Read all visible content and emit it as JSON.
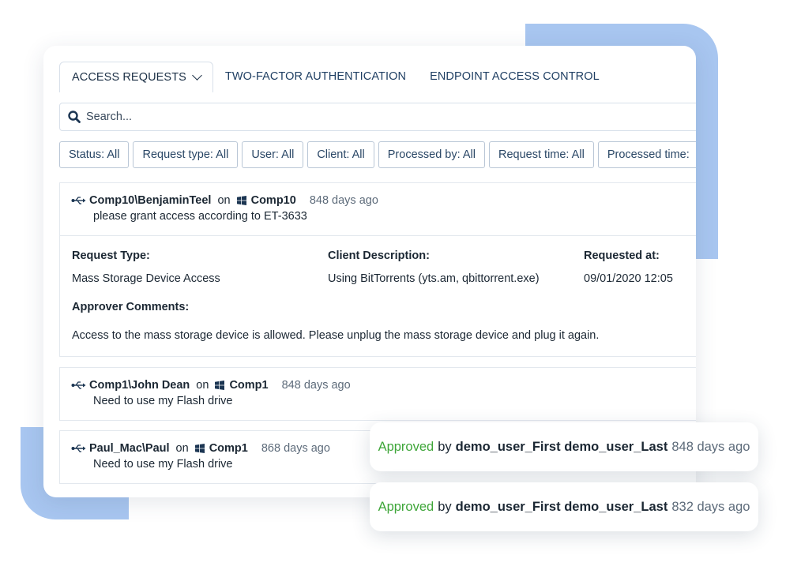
{
  "tabs": [
    {
      "label": "ACCESS REQUESTS"
    },
    {
      "label": "TWO-FACTOR AUTHENTICATION"
    },
    {
      "label": "ENDPOINT ACCESS CONTROL"
    }
  ],
  "search": {
    "placeholder": "Search..."
  },
  "filters": [
    {
      "label": "Status: All"
    },
    {
      "label": "Request type: All"
    },
    {
      "label": "User: All"
    },
    {
      "label": "Client: All"
    },
    {
      "label": "Processed by: All"
    },
    {
      "label": "Request time: All"
    },
    {
      "label": "Processed time:"
    }
  ],
  "requests": [
    {
      "user": "Comp10\\BenjaminTeel",
      "on": "on",
      "computer": "Comp10",
      "ago": "848 days ago",
      "comment": "please grant access according to ET-3633",
      "details": {
        "request_type_label": "Request Type:",
        "request_type": "Mass Storage Device Access",
        "client_description_label": "Client Description:",
        "client_description": "Using BitTorrents (yts.am, qbittorrent.exe)",
        "requested_at_label": "Requested at:",
        "requested_at": "09/01/2020 12:05",
        "approver_comments_label": "Approver Comments:",
        "approver_comments": "Access to the mass storage device is allowed. Please unplug the mass storage device and plug it again."
      }
    },
    {
      "user": "Comp1\\John Dean",
      "on": "on",
      "computer": "Comp1",
      "ago": "848 days ago",
      "comment": "Need to use my Flash drive"
    },
    {
      "user": "Paul_Mac\\Paul",
      "on": "on",
      "computer": "Comp1",
      "ago": "868 days ago",
      "comment": "Need to use my Flash drive"
    }
  ],
  "approvals": [
    {
      "status": "Approved",
      "by": "by",
      "approver": "demo_user_First demo_user_Last",
      "ago": "848 days ago"
    },
    {
      "status": "Approved",
      "by": "by",
      "approver": "demo_user_First demo_user_Last",
      "ago": "832 days ago"
    }
  ],
  "colors": {
    "accent_blue": "#a8c6f0",
    "approved_green": "#3fa63a",
    "tab_text": "#1f3f63"
  },
  "icons": {
    "search": "search-icon",
    "usb": "usb-icon",
    "windows": "windows-icon",
    "chevron": "chevron-down-icon"
  }
}
